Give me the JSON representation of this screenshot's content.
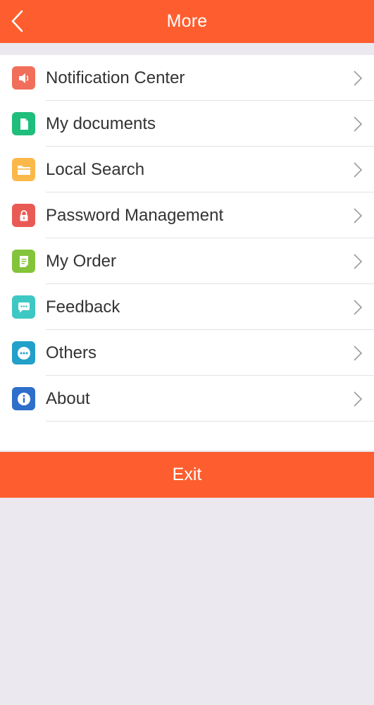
{
  "header": {
    "title": "More",
    "back_icon": "chevron-left-icon",
    "background": "#fe5e2f"
  },
  "menu": {
    "items": [
      {
        "label": "Notification Center",
        "icon": "speaker-icon",
        "color": "#f16f5a"
      },
      {
        "label": "My documents",
        "icon": "document-icon",
        "color": "#1fbe7b"
      },
      {
        "label": "Local Search",
        "icon": "folder-icon",
        "color": "#fbb84a"
      },
      {
        "label": "Password Management",
        "icon": "lock-icon",
        "color": "#ea5a55"
      },
      {
        "label": "My Order",
        "icon": "order-list-icon",
        "color": "#84c43a"
      },
      {
        "label": "Feedback",
        "icon": "chat-bubble-icon",
        "color": "#3ec8c4"
      },
      {
        "label": "Others",
        "icon": "more-dots-icon",
        "color": "#22a0c9"
      },
      {
        "label": "About",
        "icon": "info-icon",
        "color": "#2e6fc9"
      }
    ],
    "chevron_icon": "chevron-right-icon"
  },
  "exit": {
    "label": "Exit",
    "background": "#fe5e2f"
  }
}
